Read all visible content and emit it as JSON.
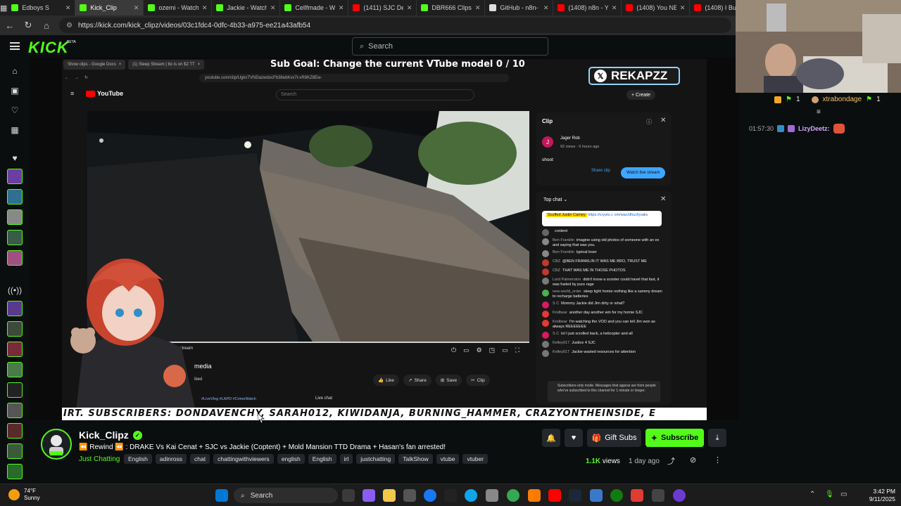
{
  "browser": {
    "tabs": [
      {
        "label": "Edboys S",
        "color": "#53fc18"
      },
      {
        "label": "Kick_Clip",
        "color": "#53fc18",
        "active": true
      },
      {
        "label": "ozemi - Watch",
        "color": "#53fc18"
      },
      {
        "label": "Jackie - Watch",
        "color": "#53fc18"
      },
      {
        "label": "Cellfmade - W",
        "color": "#53fc18"
      },
      {
        "label": "(1411) SJC De",
        "color": "#ff0000"
      },
      {
        "label": "DBR666 Clips",
        "color": "#53fc18"
      },
      {
        "label": "GitHub - n8n-",
        "color": "#dddddd"
      },
      {
        "label": "(1408) n8n - Y",
        "color": "#ff0000"
      },
      {
        "label": "(1408) You NE",
        "color": "#ff0000"
      },
      {
        "label": "(1408) I Built A",
        "color": "#ff0000"
      }
    ],
    "url": "https://kick.com/kick_clipz/videos/03c1fdc4-0dfc-4b33-a975-ee21a43afb54"
  },
  "header": {
    "logo": "KICK",
    "beta": "BETA",
    "search_placeholder": "Search"
  },
  "overlay": {
    "sub_goal": "Sub Goal: Change the current VTube model  0 / 10",
    "twitter": "REKAPZZ",
    "ticker": "IRT. SUBSCRIBERS: DONDAVENCHY, SARAH012, KIWIDANJA, BURNING_HAMMER, CRAZYONTHEINSIDE, E"
  },
  "inner_browser": {
    "tabs": [
      "Show clips - Google Docs",
      "(1) Sleep Stream | tto is on $2 TT"
    ],
    "url": "youtube.com/clip/UgkxTVNDazwdocFb38ebKvx7t-vR8KZ8Ew-",
    "yt_logo": "YouTube",
    "yt_search": "Search",
    "create": "+ Create",
    "live_label": "h live stream",
    "video_title": "media",
    "subscribed": "ibed",
    "actions": [
      "Like",
      "Share",
      "Save",
      "Clip"
    ],
    "tagline": "#LiveVlog #LAPD #CrimeWatch",
    "live_chat": "Live chat"
  },
  "clip_panel": {
    "title": "Clip",
    "avatar_letter": "J",
    "author": "Jager Rob",
    "meta": "92 views · 6 hours ago",
    "text": "shoot",
    "share": "Share clip",
    "watch": "Watch live stream"
  },
  "yt_chat": {
    "header": "Top chat",
    "pinned_name": "Scuffed Justin Carney",
    "pinned_text": "https://cryoto.c om/wac/dhucfyvakv",
    "messages": [
      {
        "name": "",
        "text": "content",
        "color": "#666"
      },
      {
        "name": "Ben Franklin",
        "text": "imagine using old photos of someone with an ex and saying that was you.",
        "color": "#888"
      },
      {
        "name": "Ben Franklin",
        "text": "typical loser",
        "color": "#888"
      },
      {
        "name": "CBZ",
        "text": "@BEN FRANKLIN IT WAS ME BRO, TRUST ME",
        "color": "#c0392b"
      },
      {
        "name": "CBZ",
        "text": "THAT WAS ME IN THOSE PHOTOS",
        "color": "#c0392b"
      },
      {
        "name": "Lord Palmerston",
        "text": "didn't know a scooter could travel that fast, it was fueled by pure rage",
        "color": "#7a7a7a"
      },
      {
        "name": "new-world_order",
        "text": "sleep tight homie nothing like a sammy dream to recharge batteries",
        "color": "#4caf50"
      },
      {
        "name": "S C",
        "text": "Mommy Jackie did Jim dirty or what?",
        "color": "#d81b60"
      },
      {
        "name": "Kndbear",
        "text": "another day another win for my homie SJC",
        "color": "#e53935"
      },
      {
        "name": "Kndbear",
        "text": "I'm watching the VOD and you can tell Jim won as always REEEEEEE",
        "color": "#e53935"
      },
      {
        "name": "S C",
        "text": "lol I just scrolled back, a helicopter and all",
        "color": "#d81b60"
      },
      {
        "name": "Kelley017",
        "text": "Justice 4 SJC",
        "color": "#777"
      },
      {
        "name": "Kelley017",
        "text": "Jackie wasted resources for attention",
        "color": "#777"
      }
    ],
    "sub_mode": "Subscribers-only mode. Messages that appear are from people who've subscribed to this channel for 1 minute or longer."
  },
  "right_chat": {
    "count1": "1",
    "user1": "xtrabondage",
    "count2": "1",
    "time": "01:57:30",
    "user2": "LizyDeetz:"
  },
  "stream": {
    "channel": "Kick_Clipz",
    "title": "⏪ Rewind ⏪ : DRAKE Vs Kai Cenat + SJC vs Jackie (Coptent) + Mold Mansion TTD Drama + Hasan's fan arrested!",
    "category": "Just Chatting",
    "tags": [
      "English",
      "adinross",
      "chat",
      "chattingwithviewers",
      "english",
      "English",
      "irl",
      "justchatting",
      "TalkShow",
      "vtube",
      "vtuber"
    ],
    "gift_subs": "Gift Subs",
    "subscribe": "Subscribe",
    "views_count": "1.1K",
    "views_label": "views",
    "ago": "1 day ago"
  },
  "taskbar": {
    "temp": "74°F",
    "condition": "Sunny",
    "search": "Search",
    "time": "3:42 PM",
    "date": "9/11/2025"
  }
}
